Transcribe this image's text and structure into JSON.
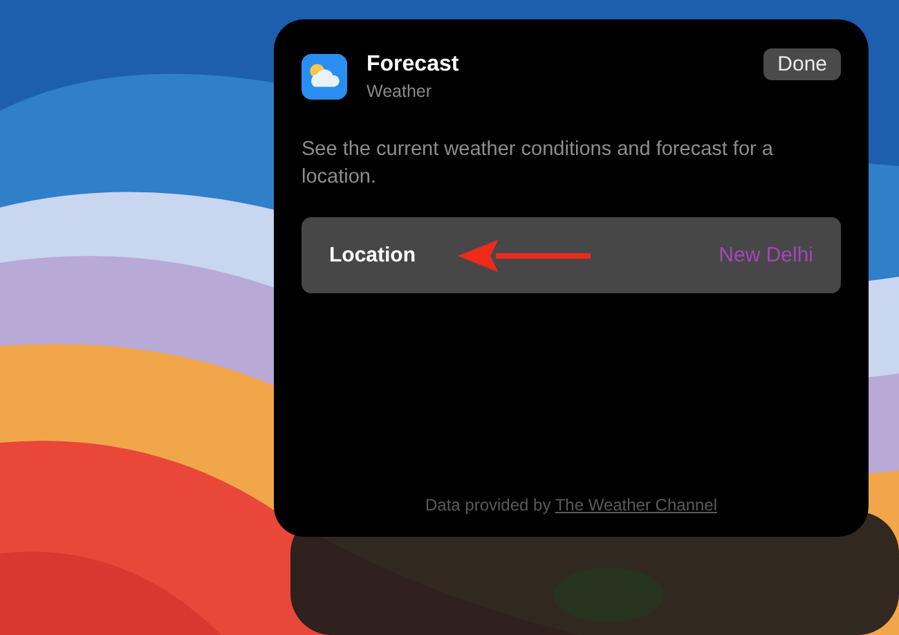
{
  "widget": {
    "title": "Forecast",
    "subtitle": "Weather",
    "done_button": "Done",
    "description": "See the current weather conditions and forecast for a location.",
    "settings": [
      {
        "label": "Location",
        "value": "New Delhi"
      }
    ],
    "attribution": {
      "text": "Data provided by",
      "link": "The Weather Channel"
    }
  }
}
